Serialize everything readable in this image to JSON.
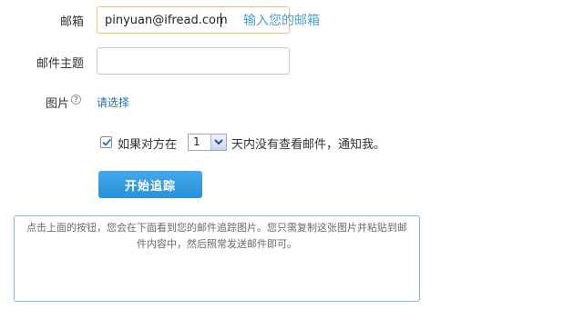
{
  "form": {
    "email": {
      "label": "邮箱",
      "value": "pinyuan@ifread.com",
      "hint": "输入您的邮箱"
    },
    "subject": {
      "label": "邮件主题",
      "value": ""
    },
    "image": {
      "label": "图片",
      "help_icon": "question-circle-icon",
      "select_link": "请选择"
    },
    "notify": {
      "checked": true,
      "prefix": "如果对方在",
      "days_selected": "1",
      "suffix": "天内没有查看邮件，通知我。"
    },
    "start_button": "开始追踪",
    "info_text": "点击上面的按钮，您会在下面看到您的邮件追踪图片。您只需复制这张图片并粘贴到邮件内容中，然后照常发送邮件即可。"
  },
  "colors": {
    "accent": "#2a90d8",
    "hint": "#4a9fd5",
    "link": "#2a6ca8",
    "focus_border": "#f0c36d",
    "info_border": "#7fb8db"
  }
}
